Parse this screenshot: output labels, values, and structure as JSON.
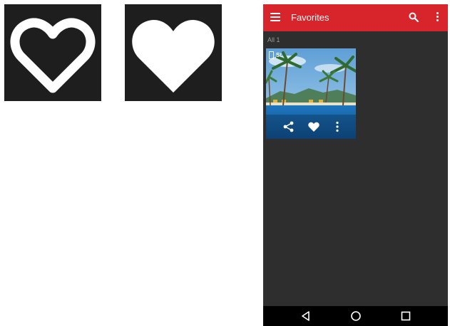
{
  "icons": [
    {
      "name": "heart-outline-icon",
      "style": "outline",
      "color": "#ffffff",
      "background": "#1e1e1e"
    },
    {
      "name": "heart-filled-icon",
      "style": "filled",
      "color": "#ffffff",
      "background": "#1e1e1e"
    }
  ],
  "app": {
    "title": "Favorites",
    "accent_color": "#d8242b",
    "background_color": "#2e2e2e",
    "menu_icon": "hamburger-menu-icon",
    "search_icon": "search-icon",
    "overflow_icon": "more-vert-icon"
  },
  "section": {
    "label": "All 1"
  },
  "items": [
    {
      "badge": "St",
      "badge_icon": "phone-device-icon",
      "actions": [
        {
          "name": "share-icon"
        },
        {
          "name": "heart-icon"
        },
        {
          "name": "more-vert-icon"
        }
      ]
    }
  ],
  "navbar": {
    "buttons": [
      {
        "name": "back-icon"
      },
      {
        "name": "home-icon"
      },
      {
        "name": "recents-icon"
      }
    ]
  }
}
